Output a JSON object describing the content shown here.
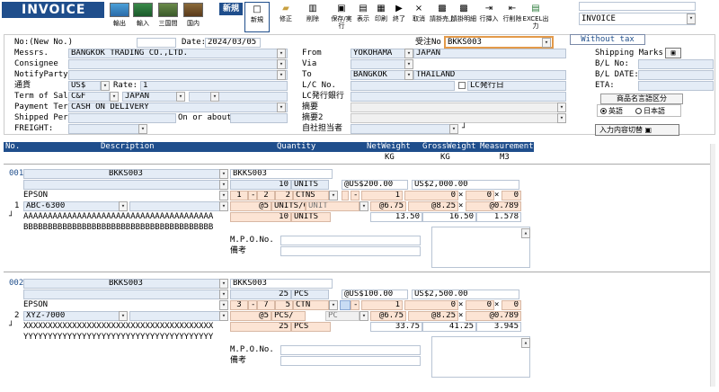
{
  "toolbar": {
    "title": "INVOICE",
    "imgs": [
      "輸出",
      "輸入",
      "三国間",
      "国内"
    ],
    "mode": "新規",
    "buttons": [
      "新規",
      "修正",
      "削除",
      "保存/実行",
      "表示",
      "印刷",
      "終了",
      "取消",
      "請掛売上",
      "請掛明細",
      "行挿入",
      "行削除",
      "EXCEL出力"
    ],
    "right_select": "INVOICE",
    "colors": {
      "title_bg": "#1f4e8c",
      "accent": "#e39a4a"
    }
  },
  "header": {
    "no_label": "No:(New No.)",
    "date_label": "Date:",
    "date_value": "2024/03/05",
    "order_label": "受注No",
    "order_value": "BKKS003",
    "messrs_label": "Messrs.",
    "messrs_value": "BANGKOK TRADING CO.,LTD.",
    "consignee_label": "Consignee",
    "notify_label": "NotifyParty",
    "currency_label": "通貨",
    "currency_value": "US$",
    "rate_label": "Rate:",
    "rate_value": "1",
    "term_label": "Term of Sale",
    "term_value": "C&F",
    "term_country": "JAPAN",
    "payment_label": "Payment Term",
    "payment_value": "CASH ON DELIVERY",
    "shipped_label": "Shipped Per",
    "shipped_value": "On or about",
    "freight_label": "FREIGHT:",
    "from_label": "From",
    "from_value": "YOKOHAMA",
    "from_country": "JAPAN",
    "via_label": "Via",
    "to_label": "To",
    "to_value": "BANGKOK",
    "to_country": "THAILAND",
    "lc_label": "L/C No.",
    "lc_bank_btn": "LC発行日",
    "lc_issue_label": "LC発行銀行",
    "remark1_label": "摘要",
    "remark2_label": "摘要2",
    "staff_label": "自社担当者",
    "without_tax": "Without tax",
    "shipping_marks": "Shipping Marks",
    "bl_no": "B/L No:",
    "bl_date": "B/L DATE:",
    "eta": "ETA:",
    "lang_label": "商品名言語区分",
    "lang_en": "英語",
    "lang_ja": "日本語",
    "input_switch": "入力内容切替"
  },
  "columns": {
    "no": "No.",
    "desc": "Description",
    "qty": "Quantity",
    "nw": "NetWeight",
    "gw": "GrossWeight",
    "meas": "Measurement",
    "nw_unit": "KG",
    "gw_unit": "KG",
    "meas_unit": "M3"
  },
  "items": [
    {
      "no": "001",
      "row": "1",
      "code": "BKKS003",
      "code2": "BKKS003",
      "qty": "10",
      "unit": "UNITS",
      "price": "@US$200.00",
      "amount": "US$2,000.00",
      "name": "EPSON",
      "model": "ABC-6300",
      "desc1": "AAAAAAAAAAAAAAAAAAAAAAAAAAAAAAAAAAAAAAA",
      "desc2": "BBBBBBBBBBBBBBBBBBBBBBBBBBBBBBBBBBBBBBB",
      "pk_from": "1",
      "pk_dash": "-",
      "pk_to": "2",
      "pk_qty": "2",
      "pk_unit": "CTNS",
      "c1": "1",
      "c2": "0",
      "c3": "0",
      "per_qty": "@5",
      "per_unit": "UNITS/CT",
      "per_unit2": "UNIT",
      "nw_per": "@6.75",
      "gw_per": "@8.25",
      "m_per": "@0.789",
      "tot_qty": "10",
      "tot_unit": "UNITS",
      "nw": "13.50",
      "gw": "16.50",
      "meas": "1.578",
      "mpo": "M.P.O.No.",
      "note": "備考"
    },
    {
      "no": "002",
      "row": "2",
      "code": "BKKS003",
      "code2": "BKKS003",
      "qty": "25",
      "unit": "PCS",
      "price": "@US$100.00",
      "amount": "US$2,500.00",
      "name": "EPSON",
      "model": "XYZ-7000",
      "desc1": "XXXXXXXXXXXXXXXXXXXXXXXXXXXXXXXXXXXXXXX",
      "desc2": "YYYYYYYYYYYYYYYYYYYYYYYYYYYYYYYYYYYYYYY",
      "pk_from": "3",
      "pk_dash": "-",
      "pk_to": "7",
      "pk_qty": "5",
      "pk_unit": "CTN",
      "c1": "1",
      "c2": "0",
      "c3": "0",
      "per_qty": "@5",
      "per_unit": "PCS/",
      "per_unit2": "PC",
      "nw_per": "@6.75",
      "gw_per": "@8.25",
      "m_per": "@0.789",
      "tot_qty": "25",
      "tot_unit": "PCS",
      "nw": "33.75",
      "gw": "41.25",
      "meas": "3.945",
      "mpo": "M.P.O.No.",
      "note": "備考"
    }
  ]
}
